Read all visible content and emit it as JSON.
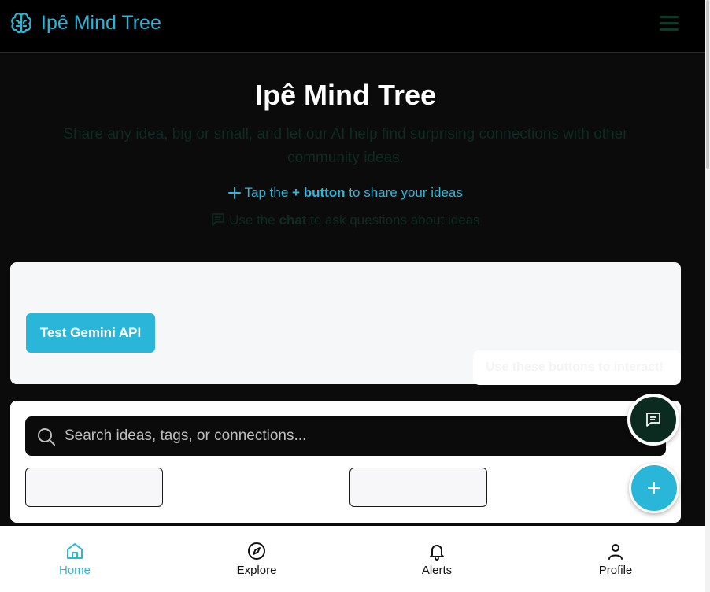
{
  "header": {
    "brand": "Ipê Mind Tree",
    "brand_icon": "brain-icon",
    "menu_icon": "hamburger-menu-icon"
  },
  "hero": {
    "title": "Ipê Mind Tree",
    "subtitle": "Share any idea, big or small, and let our AI help find surprising connections with other community ideas.",
    "tap_hint": {
      "prefix": "Tap the",
      "plus": "+",
      "button_word": "button",
      "suffix": "to share your ideas"
    },
    "chat_hint": {
      "prefix": "Use the",
      "chat_word": "chat",
      "suffix": "to ask questions about ideas"
    }
  },
  "gemini_card": {
    "button_label": "Test Gemini API"
  },
  "tooltip": {
    "text": "Use these buttons to interact!"
  },
  "search": {
    "placeholder": "Search ideas, tags, or connections..."
  },
  "fabs": {
    "chat_icon": "chat-icon",
    "add_icon": "plus-icon"
  },
  "bottom_nav": {
    "items": [
      {
        "label": "Home",
        "icon": "home-icon",
        "active": true
      },
      {
        "label": "Explore",
        "icon": "compass-icon",
        "active": false
      },
      {
        "label": "Alerts",
        "icon": "bell-icon",
        "active": false
      },
      {
        "label": "Profile",
        "icon": "user-icon",
        "active": false
      }
    ]
  },
  "colors": {
    "accent": "#29b6d9",
    "background": "#0b0b0c",
    "chat_fab": "#0b2b20",
    "muted_text": "#0e2a22"
  }
}
